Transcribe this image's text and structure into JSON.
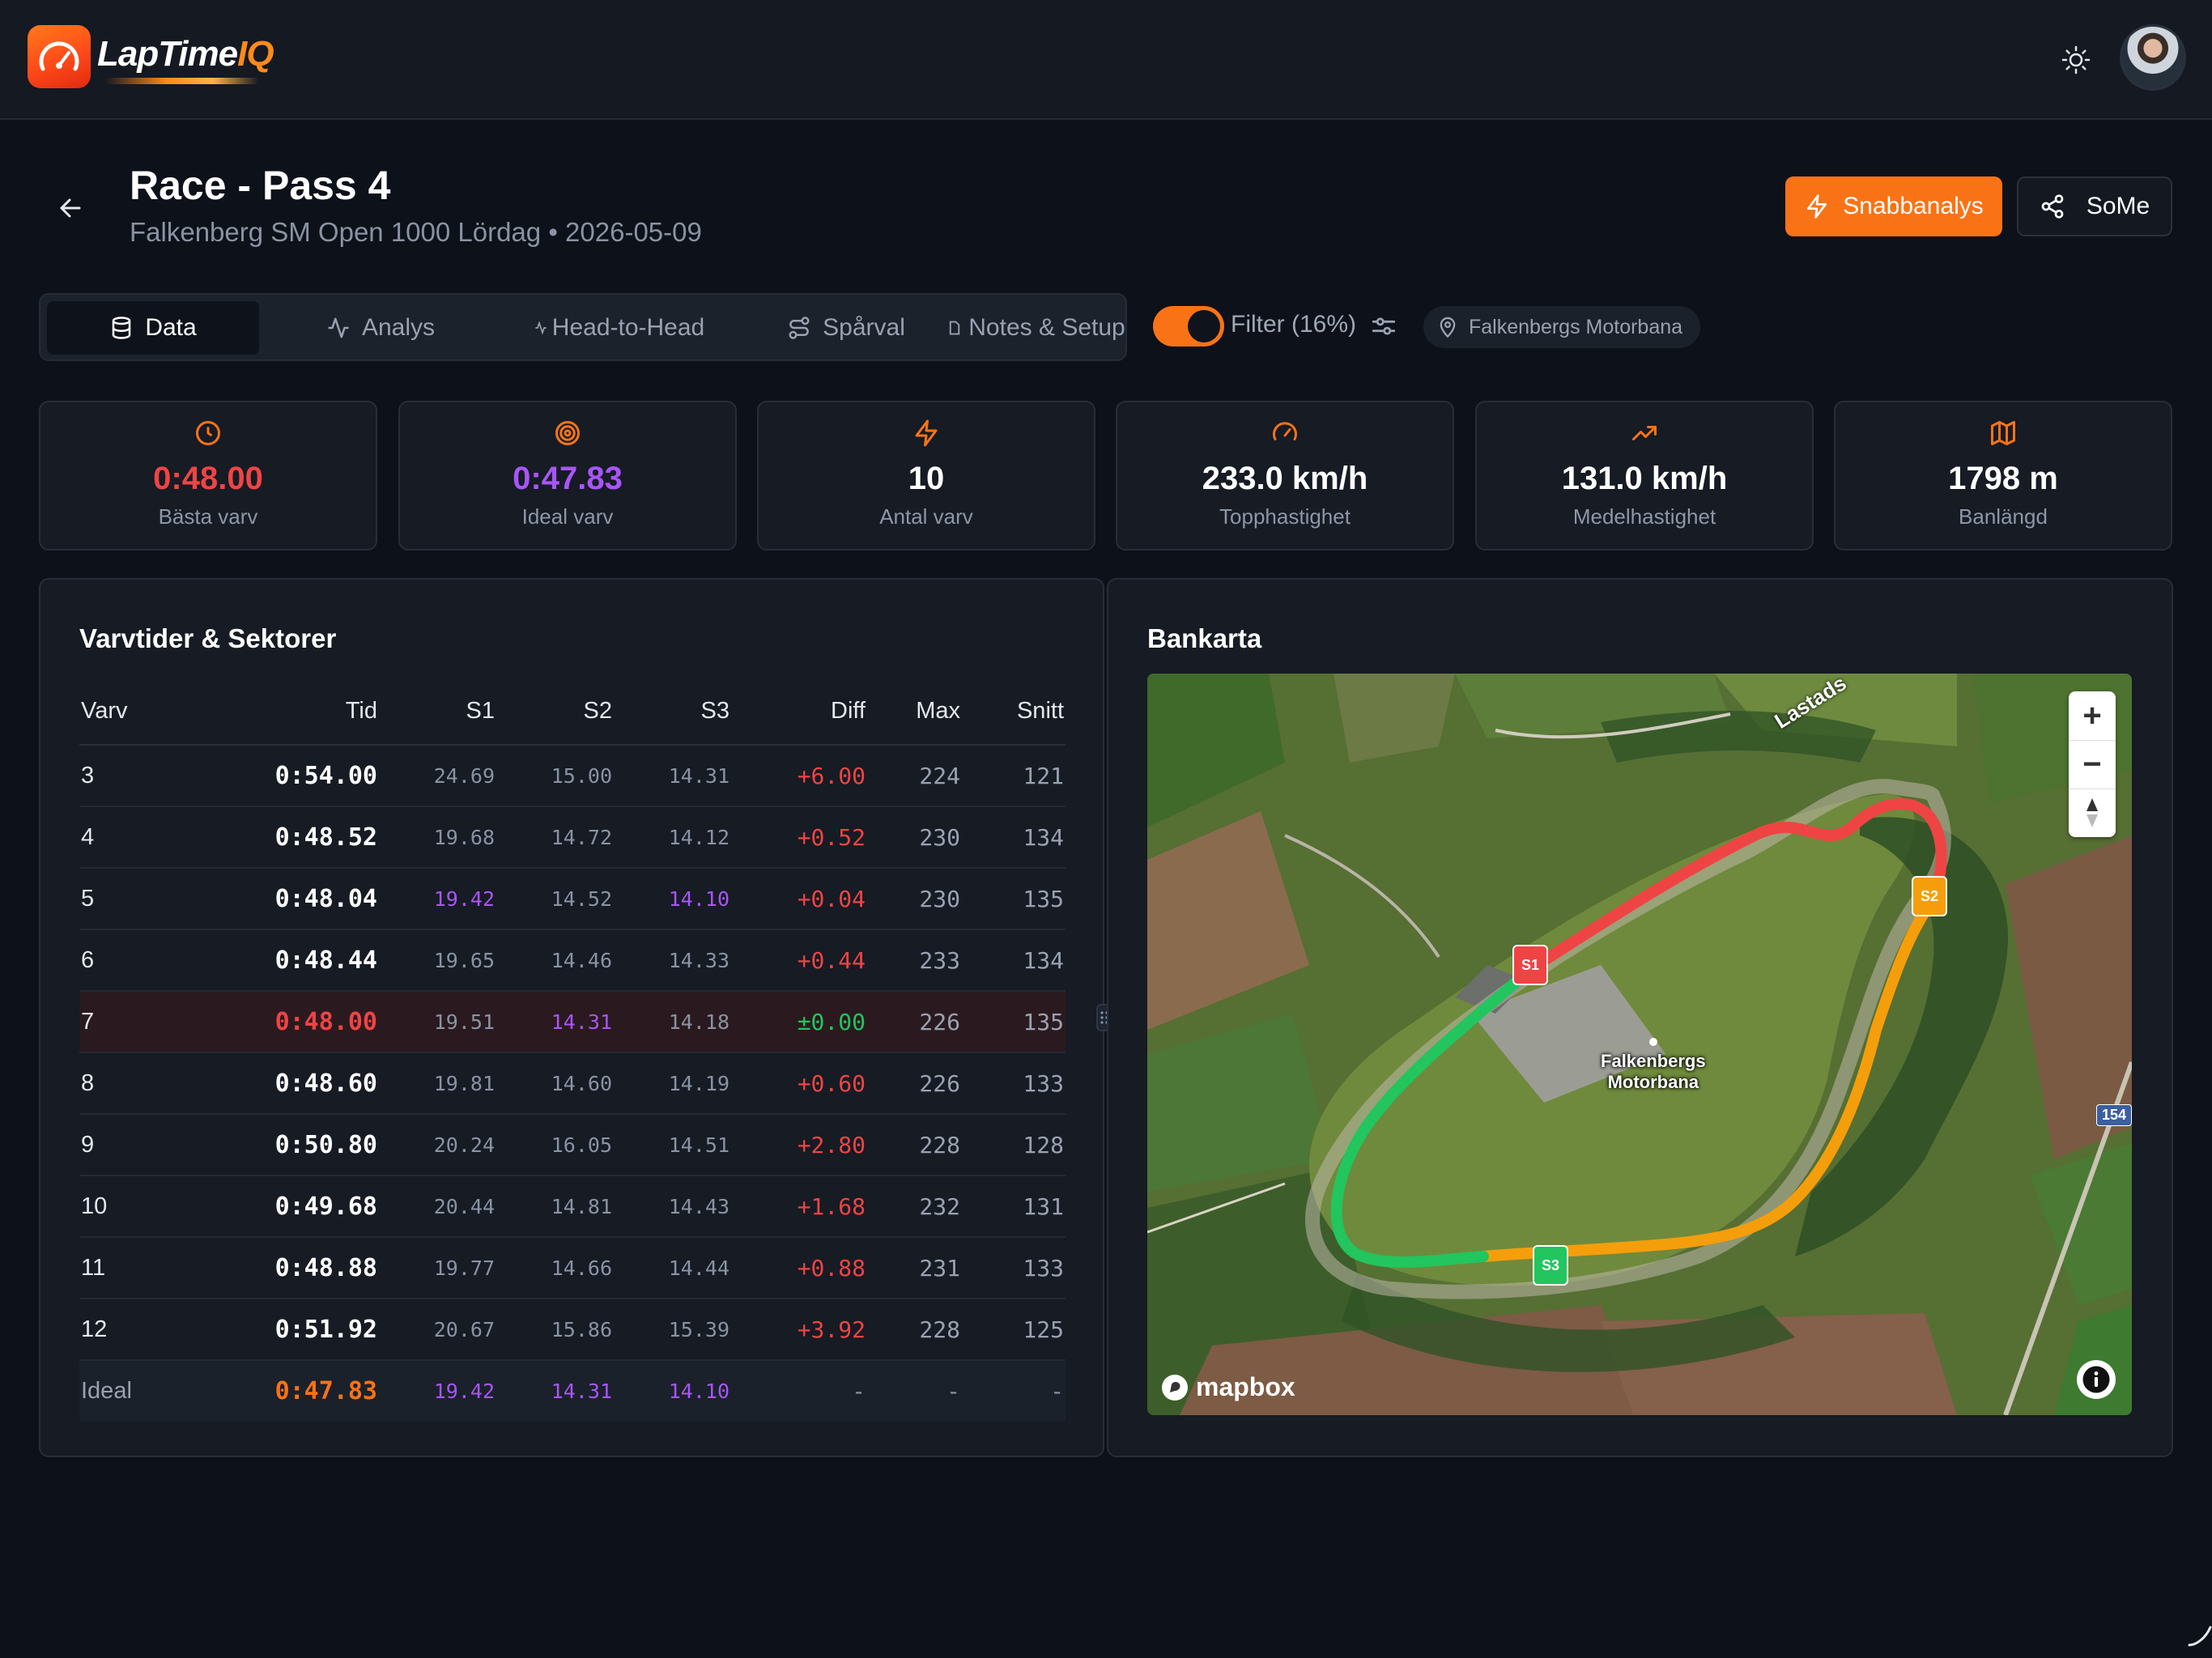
{
  "app": {
    "logo_part1": "LapTime",
    "logo_part2": "IQ"
  },
  "header": {
    "title": "Race - Pass 4",
    "subtitle": "Falkenberg SM Open 1000 Lördag • 2026-05-09",
    "quick_button": "Snabbanalys",
    "share_button": "SoMe"
  },
  "tabs": [
    {
      "label": "Data",
      "icon": "database-icon",
      "active": true
    },
    {
      "label": "Analys",
      "icon": "activity-icon",
      "active": false
    },
    {
      "label": "Head-to-Head",
      "icon": "activity-small-icon",
      "active": false
    },
    {
      "label": "Spårval",
      "icon": "route-icon",
      "active": false
    },
    {
      "label": "Notes & Setup",
      "icon": "file-icon",
      "active": false
    }
  ],
  "filter": {
    "label": "Filter (16%)",
    "enabled": true
  },
  "track_chip": "Falkenbergs Motorbana",
  "stats": [
    {
      "value": "0:48.00",
      "label": "Bästa varv",
      "color": "#ef4444",
      "icon": "clock-icon"
    },
    {
      "value": "0:47.83",
      "label": "Ideal varv",
      "color": "#a855f7",
      "icon": "target-icon"
    },
    {
      "value": "10",
      "label": "Antal varv",
      "color": "#ffffff",
      "icon": "zap-icon"
    },
    {
      "value": "233.0 km/h",
      "label": "Topphastighet",
      "color": "#ffffff",
      "icon": "gauge-icon"
    },
    {
      "value": "131.0 km/h",
      "label": "Medelhastighet",
      "color": "#ffffff",
      "icon": "trending-up-icon"
    },
    {
      "value": "1798 m",
      "label": "Banlängd",
      "color": "#ffffff",
      "icon": "map-icon"
    }
  ],
  "laps_panel": {
    "title": "Varvtider & Sektorer",
    "columns": [
      "Varv",
      "Tid",
      "S1",
      "S2",
      "S3",
      "Diff",
      "Max",
      "Snitt"
    ],
    "rows": [
      {
        "lap": "3",
        "time": "0:54.00",
        "s1": "24.69",
        "s2": "15.00",
        "s3": "14.31",
        "diff": "+6.00",
        "max": "224",
        "avg": "121"
      },
      {
        "lap": "4",
        "time": "0:48.52",
        "s1": "19.68",
        "s2": "14.72",
        "s3": "14.12",
        "diff": "+0.52",
        "max": "230",
        "avg": "134"
      },
      {
        "lap": "5",
        "time": "0:48.04",
        "s1": "19.42",
        "s2": "14.52",
        "s3": "14.10",
        "diff": "+0.04",
        "max": "230",
        "avg": "135"
      },
      {
        "lap": "6",
        "time": "0:48.44",
        "s1": "19.65",
        "s2": "14.46",
        "s3": "14.33",
        "diff": "+0.44",
        "max": "233",
        "avg": "134"
      },
      {
        "lap": "7",
        "time": "0:48.00",
        "s1": "19.51",
        "s2": "14.31",
        "s3": "14.18",
        "diff": "±0.00",
        "max": "226",
        "avg": "135"
      },
      {
        "lap": "8",
        "time": "0:48.60",
        "s1": "19.81",
        "s2": "14.60",
        "s3": "14.19",
        "diff": "+0.60",
        "max": "226",
        "avg": "133"
      },
      {
        "lap": "9",
        "time": "0:50.80",
        "s1": "20.24",
        "s2": "16.05",
        "s3": "14.51",
        "diff": "+2.80",
        "max": "228",
        "avg": "128"
      },
      {
        "lap": "10",
        "time": "0:49.68",
        "s1": "20.44",
        "s2": "14.81",
        "s3": "14.43",
        "diff": "+1.68",
        "max": "232",
        "avg": "131"
      },
      {
        "lap": "11",
        "time": "0:48.88",
        "s1": "19.77",
        "s2": "14.66",
        "s3": "14.44",
        "diff": "+0.88",
        "max": "231",
        "avg": "133"
      },
      {
        "lap": "12",
        "time": "0:51.92",
        "s1": "20.67",
        "s2": "15.86",
        "s3": "15.39",
        "diff": "+3.92",
        "max": "228",
        "avg": "125"
      }
    ],
    "ideal": {
      "label": "Ideal",
      "time": "0:47.83",
      "s1": "19.42",
      "s2": "14.31",
      "s3": "14.10",
      "diff": "-",
      "max": "-",
      "avg": "-"
    }
  },
  "map_panel": {
    "title": "Bankarta",
    "place_label_1": "Falkenbergs",
    "place_label_2": "Motorbana",
    "road_label": "Lastads",
    "road_badge": "154",
    "sector_labels": [
      "S1",
      "S2",
      "S3"
    ],
    "attribution": "mapbox",
    "zoom_in": "+",
    "zoom_out": "−"
  },
  "colors": {
    "accent": "#f97316",
    "best": "#ef4444",
    "ideal": "#a855f7",
    "good": "#22c55e",
    "sector1": "#ef4444",
    "sector2": "#f59e0b",
    "sector3": "#22c55e"
  }
}
